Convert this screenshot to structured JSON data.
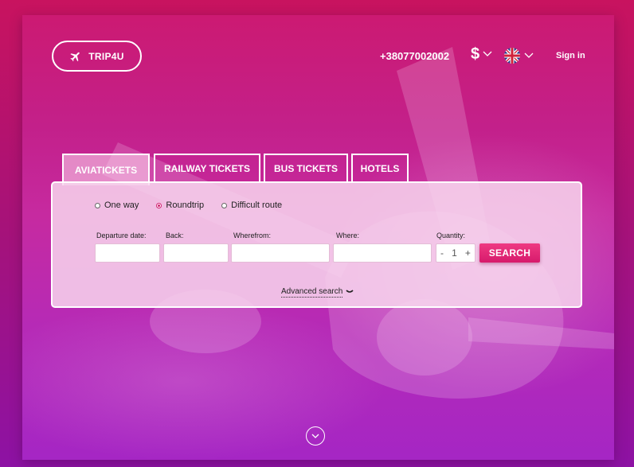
{
  "header": {
    "logo_text": "TRIP4U",
    "phone": "+38077002002",
    "currency_symbol": "$",
    "signin_label": "Sign in"
  },
  "tabs": [
    {
      "label": "AVIATICKETS",
      "active": true
    },
    {
      "label": "RAILWAY TICKETS",
      "active": false
    },
    {
      "label": "BUS TICKETS",
      "active": false
    },
    {
      "label": "HOTELS",
      "active": false
    }
  ],
  "search": {
    "trip_types": [
      {
        "label": "One way",
        "checked": false
      },
      {
        "label": "Roundtrip",
        "checked": true
      },
      {
        "label": "Difficult route",
        "checked": false
      }
    ],
    "labels": {
      "departure": "Departure date:",
      "back": "Back:",
      "wherefrom": "Wherefrom:",
      "where": "Where:",
      "quantity": "Quantity:"
    },
    "values": {
      "departure": "",
      "back": "",
      "wherefrom": "",
      "where": ""
    },
    "quantity": {
      "minus": "-",
      "value": "1",
      "plus": "+"
    },
    "search_label": "SEARCH",
    "advanced_label": "Advanced search"
  },
  "colors": {
    "accent": "#e02a78",
    "hero_top": "#cc1a72",
    "hero_bottom": "#a526c4"
  },
  "icons": {
    "logo": "airplane-icon",
    "currency_dropdown": "chevron-down-icon",
    "language": "uk-flag-icon",
    "scroll": "chevron-down-circle-icon"
  }
}
